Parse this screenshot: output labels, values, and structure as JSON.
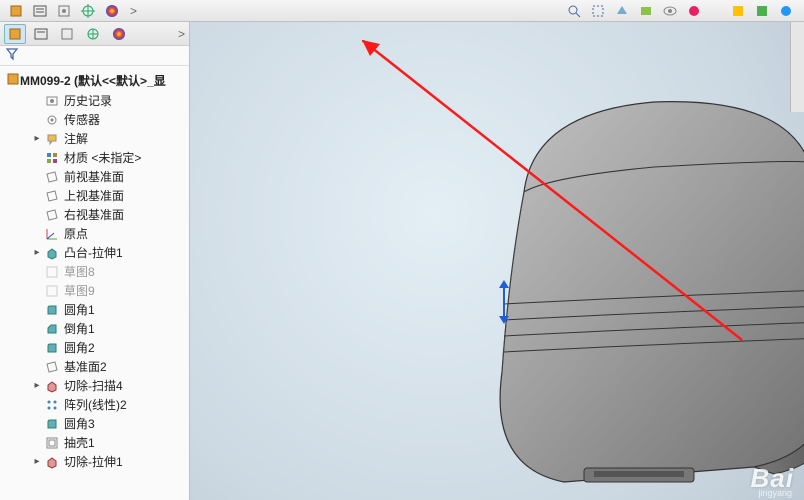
{
  "root_name": "MM099-2  (默认<<默认>_显",
  "filter_icon": "funnel",
  "tabs_chevron": ">",
  "tree": [
    {
      "label": "历史记录",
      "icon": "history",
      "indent": true,
      "exp": "",
      "dim": false
    },
    {
      "label": "传感器",
      "icon": "sensor",
      "indent": true,
      "exp": "",
      "dim": false
    },
    {
      "label": "注解",
      "icon": "annotation",
      "indent": true,
      "exp": "▸",
      "dim": false
    },
    {
      "label": "材质 <未指定>",
      "icon": "material",
      "indent": true,
      "exp": "",
      "dim": false
    },
    {
      "label": "前视基准面",
      "icon": "plane",
      "indent": true,
      "exp": "",
      "dim": false
    },
    {
      "label": "上视基准面",
      "icon": "plane",
      "indent": true,
      "exp": "",
      "dim": false
    },
    {
      "label": "右视基准面",
      "icon": "plane",
      "indent": true,
      "exp": "",
      "dim": false
    },
    {
      "label": "原点",
      "icon": "origin",
      "indent": true,
      "exp": "",
      "dim": false
    },
    {
      "label": "凸台-拉伸1",
      "icon": "extrude",
      "indent": true,
      "exp": "▸",
      "dim": false
    },
    {
      "label": "草图8",
      "icon": "sketch",
      "indent": true,
      "exp": "",
      "dim": true
    },
    {
      "label": "草图9",
      "icon": "sketch",
      "indent": true,
      "exp": "",
      "dim": true
    },
    {
      "label": "圆角1",
      "icon": "fillet",
      "indent": true,
      "exp": "",
      "dim": false
    },
    {
      "label": "倒角1",
      "icon": "chamfer",
      "indent": true,
      "exp": "",
      "dim": false
    },
    {
      "label": "圆角2",
      "icon": "fillet",
      "indent": true,
      "exp": "",
      "dim": false
    },
    {
      "label": "基准面2",
      "icon": "plane",
      "indent": true,
      "exp": "",
      "dim": false
    },
    {
      "label": "切除-扫描4",
      "icon": "cut",
      "indent": true,
      "exp": "▸",
      "dim": false
    },
    {
      "label": "阵列(线性)2",
      "icon": "pattern",
      "indent": true,
      "exp": "",
      "dim": false
    },
    {
      "label": "圆角3",
      "icon": "fillet",
      "indent": true,
      "exp": "",
      "dim": false
    },
    {
      "label": "抽壳1",
      "icon": "shell",
      "indent": true,
      "exp": "",
      "dim": false
    },
    {
      "label": "切除-拉伸1",
      "icon": "cut",
      "indent": true,
      "exp": "▸",
      "dim": false
    }
  ],
  "side_tab_label": "",
  "watermark": "Bai",
  "watermark_sub": "jingyang"
}
